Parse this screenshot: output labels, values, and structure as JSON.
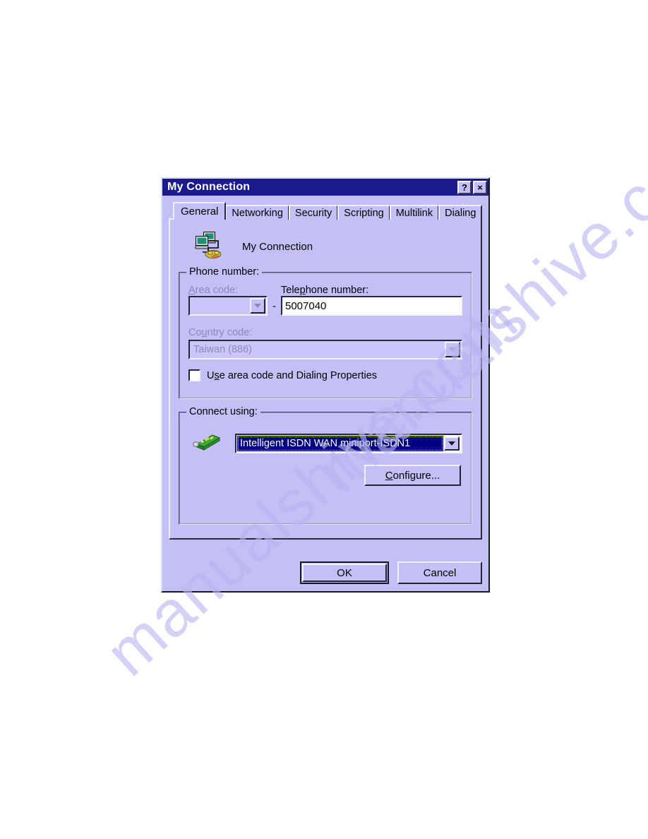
{
  "window": {
    "title": "My Connection",
    "help_button": "?",
    "close_button": "×"
  },
  "tabs": [
    {
      "label": "General",
      "active": true
    },
    {
      "label": "Networking",
      "active": false
    },
    {
      "label": "Security",
      "active": false
    },
    {
      "label": "Scripting",
      "active": false
    },
    {
      "label": "Multilink",
      "active": false
    },
    {
      "label": "Dialing",
      "active": false
    }
  ],
  "general": {
    "connection_name": "My Connection",
    "connection_icon": "computer-modem-icon",
    "phone_number_group": {
      "title": "Phone number:",
      "area_code_label": "Area code:",
      "area_code_value": "",
      "area_code_disabled": true,
      "separator": "-",
      "telephone_label": "Telephone number:",
      "telephone_value": "5007040",
      "country_code_label": "Country code:",
      "country_code_value": "Taiwan (886)",
      "country_code_disabled": true,
      "use_area_code_label": "Use area code and Dialing Properties",
      "use_area_code_checked": false
    },
    "connect_using_group": {
      "title": "Connect using:",
      "device_icon": "network-adapter-card-icon",
      "device_value": "Intelligent ISDN WAN miniport-ISDN1",
      "device_selected": true,
      "configure_label": "Configure..."
    }
  },
  "footer": {
    "ok_label": "OK",
    "cancel_label": "Cancel"
  },
  "watermark": {
    "text": "manualshive.com"
  },
  "colors": {
    "dialog_face": "#c2c0f7",
    "titlebar": "#1b1b8f",
    "titlebar_text": "#ffffff",
    "selection": "#000080",
    "disabled_text": "#8c8ab5",
    "page_background": "#ffffff"
  }
}
